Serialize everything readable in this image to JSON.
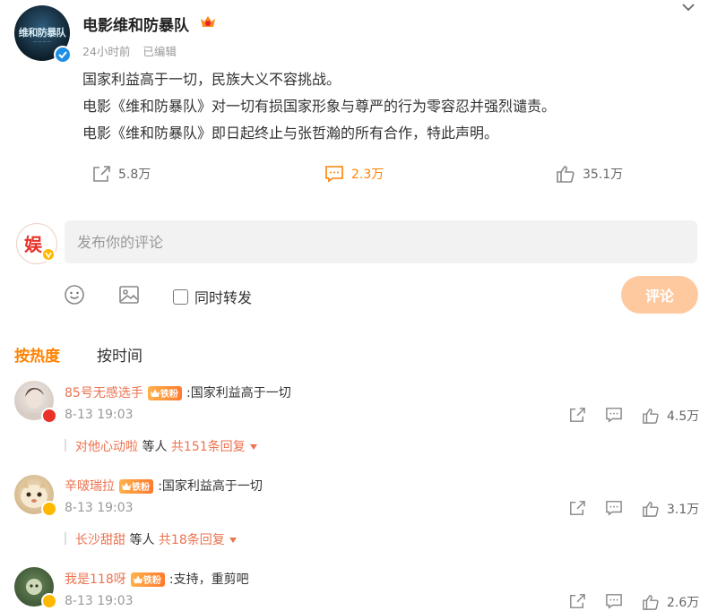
{
  "post": {
    "author": "电影维和防暴队",
    "time": "24小时前",
    "edited": "已编辑",
    "avatar_text": "维和防暴队",
    "lines": [
      "国家利益高于一切，民族大义不容挑战。",
      "电影《维和防暴队》对一切有损国家形象与尊严的行为零容忍并强烈谴责。",
      "电影《维和防暴队》即日起终止与张哲瀚的所有合作，特此声明。"
    ],
    "share_count": "5.8万",
    "comment_count": "2.3万",
    "like_count": "35.1万"
  },
  "composer": {
    "placeholder": "发布你的评论",
    "repost_label": "同时转发",
    "submit_label": "评论"
  },
  "sort": {
    "hot": "按热度",
    "time": "按时间"
  },
  "comments": [
    {
      "name": "85号无感选手",
      "badge": "铁粉",
      "text": ":国家利益高于一切",
      "time": "8-13 19:03",
      "likes": "4.5万",
      "reply_name": "对他心动啦",
      "reply_mid": "等人",
      "reply_count": "共151条回复"
    },
    {
      "name": "辛啵瑞拉",
      "badge": "铁粉",
      "text": ":国家利益高于一切",
      "time": "8-13 19:03",
      "likes": "3.1万",
      "reply_name": "长沙甜甜",
      "reply_mid": "等人",
      "reply_count": "共18条回复"
    },
    {
      "name": "我是118呀",
      "badge": "铁粉",
      "text": ":支持，重剪吧",
      "time": "8-13 19:03",
      "likes": "2.6万"
    }
  ],
  "colors": {
    "accent": "#ff8200",
    "username": "#eb7350",
    "verified": "#1f8fe6",
    "submit_disabled": "#ffc9a0"
  },
  "icons": [
    "chevron-down-icon",
    "share-icon",
    "comment-icon",
    "like-icon",
    "emoji-icon",
    "image-icon",
    "crown-icon",
    "verified-icon"
  ]
}
